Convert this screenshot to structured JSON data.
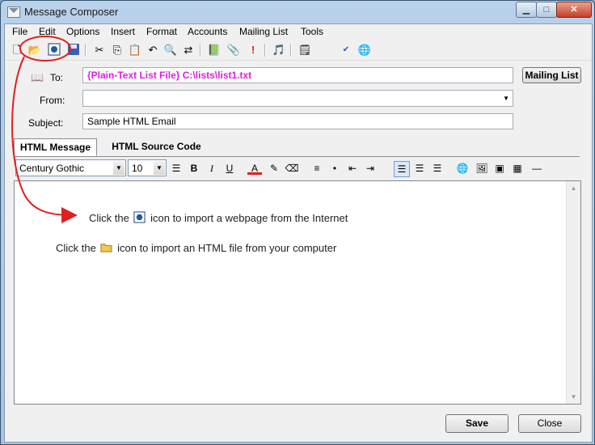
{
  "window": {
    "title": "Message Composer"
  },
  "menu": [
    "File",
    "Edit",
    "Options",
    "Insert",
    "Format",
    "Accounts",
    "Mailing List",
    "Tools"
  ],
  "form": {
    "to_label": "To:",
    "to_value": "{Plain-Text List File}  C:\\lists\\list1.txt",
    "from_label": "From:",
    "from_value": "",
    "subject_label": "Subject:",
    "subject_value": "Sample HTML Email",
    "mailing_list_button": "Mailing List"
  },
  "tabs": [
    "HTML Message",
    "HTML Source Code"
  ],
  "format": {
    "font": "Century Gothic",
    "size": "10"
  },
  "body": {
    "line1_before": "Click the",
    "line1_after": "icon to import a webpage from the Internet",
    "line2_before": "Click the",
    "line2_after": "icon to import an HTML file from your computer"
  },
  "buttons": {
    "save": "Save",
    "close": "Close"
  },
  "colors": {
    "to_text": "#e01ee0",
    "annotation_red": "#e02020",
    "titlebar": "#b9d1ea"
  }
}
